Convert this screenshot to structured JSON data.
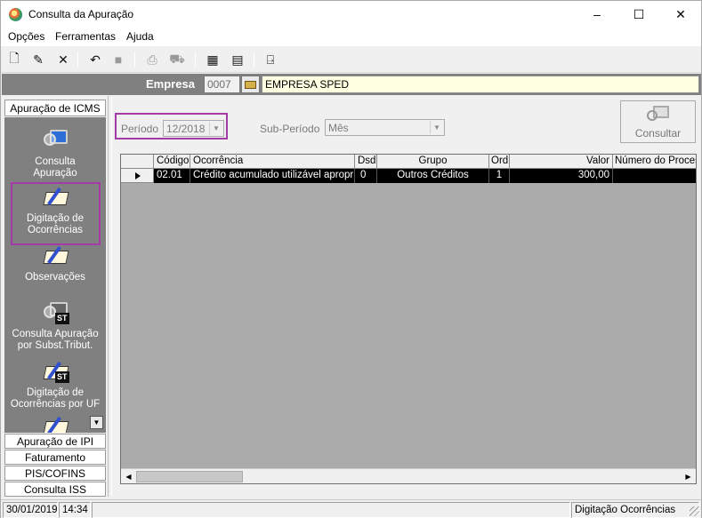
{
  "window": {
    "title": "Consulta da Apuração",
    "controls": {
      "minimize": "–",
      "maximize": "☐",
      "close": "✕"
    }
  },
  "menu": {
    "items": [
      "Opções",
      "Ferramentas",
      "Ajuda"
    ]
  },
  "toolbar": {
    "icons": [
      "new-icon",
      "edit-icon",
      "delete-icon",
      "undo-icon",
      "stop-icon",
      "print-icon",
      "truck-icon",
      "calculator-icon",
      "disk-file-icon",
      "exit-door-icon"
    ]
  },
  "empresa": {
    "label": "Empresa",
    "code": "0007",
    "name": "EMPRESA SPED"
  },
  "sidebar": {
    "header": "Apuração de ICMS",
    "items": [
      {
        "label_line1": "Consulta",
        "label_line2": "Apuração",
        "icon": "monitor-magnifier-icon"
      },
      {
        "label_line1": "Digitação de",
        "label_line2": "Ocorrências",
        "icon": "book-pen-icon"
      },
      {
        "label_line1": "Observações",
        "label_line2": "",
        "icon": "book-pen-icon"
      },
      {
        "label_line1": "Consulta  Apuração",
        "label_line2": "por Subst.Tribut.",
        "icon": "st-magnifier-icon"
      },
      {
        "label_line1": "Digitação de",
        "label_line2": "Ocorrências por UF",
        "icon": "st-book-icon"
      }
    ],
    "sections": [
      "Apuração de IPI",
      "Faturamento",
      "PIS/COFINS",
      "Consulta ISS"
    ]
  },
  "filters": {
    "periodo_label": "Período",
    "periodo_value": "12/2018",
    "subperiodo_label": "Sub-Período",
    "subperiodo_value": "Mês"
  },
  "consultar_label": "Consultar",
  "grid": {
    "columns": [
      "Código",
      "Ocorrência",
      "Dsd",
      "Grupo",
      "Ord",
      "Valor",
      "Número do Processo"
    ],
    "rows": [
      [
        "02.01",
        "Crédito acumulado utilizável apropriado",
        "0",
        "Outros Créditos",
        "1",
        "300,00",
        ""
      ]
    ]
  },
  "status": {
    "date": "30/01/2019",
    "time": "14:34",
    "mode": "Digitação Ocorrências"
  },
  "colors": {
    "highlight": "#a33aa5",
    "panel": "#808080",
    "empresa_bg": "#ffffe1",
    "selected_row": "#000000"
  }
}
